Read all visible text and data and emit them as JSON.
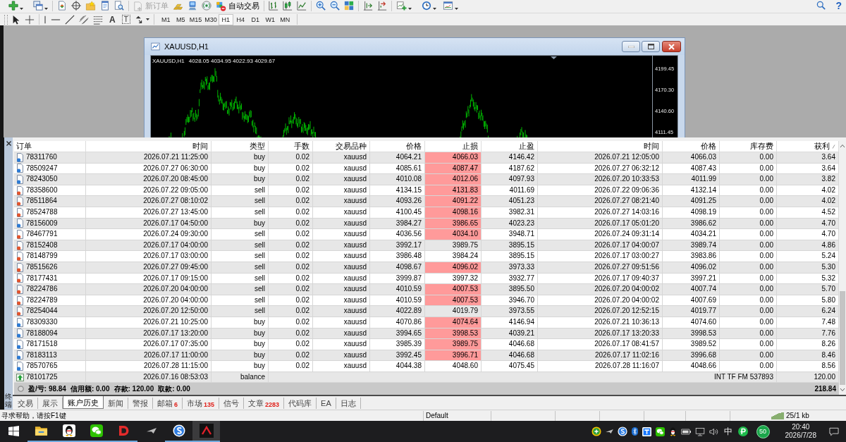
{
  "toolbar": {
    "buttons": [
      {
        "label": "新订单",
        "disabled": true
      },
      {
        "label": "自动交易",
        "disabled": false
      }
    ],
    "help": "?"
  },
  "drawing_toolbar": {
    "text_tool": "A",
    "label_tool": "T"
  },
  "timeframes": [
    {
      "label": "M1",
      "selected": false
    },
    {
      "label": "M5",
      "selected": false
    },
    {
      "label": "M15",
      "selected": false
    },
    {
      "label": "M30",
      "selected": false
    },
    {
      "label": "H1",
      "selected": true
    },
    {
      "label": "H4",
      "selected": false
    },
    {
      "label": "D1",
      "selected": false
    },
    {
      "label": "W1",
      "selected": false
    },
    {
      "label": "MN",
      "selected": false
    }
  ],
  "chart_window": {
    "title": "XAUUSD,H1",
    "symbol": "XAUUSD,H1",
    "ohlc": "4028.05 4034.95 4022.93 4029.67",
    "price_labels": [
      "4199.45",
      "4170.30",
      "4140.60",
      "4111.45"
    ]
  },
  "terminal": {
    "title": "终端",
    "columns": [
      {
        "label": "订单",
        "sorted": false
      },
      {
        "label": "时间",
        "sorted": false
      },
      {
        "label": "类型",
        "sorted": false
      },
      {
        "label": "手数",
        "sorted": false
      },
      {
        "label": "交易品种",
        "sorted": false
      },
      {
        "label": "价格",
        "sorted": false
      },
      {
        "label": "止损",
        "sorted": false
      },
      {
        "label": "止盈",
        "sorted": false
      },
      {
        "label": "时间",
        "sorted": false
      },
      {
        "label": "价格",
        "sorted": false
      },
      {
        "label": "库存费",
        "sorted": false
      },
      {
        "label": "获利",
        "sorted": true
      }
    ],
    "rows": [
      {
        "kind": "buy",
        "order": "78311760",
        "open_time": "2026.07.21 11:25:00",
        "type": "buy",
        "size": "0.02",
        "symbol": "xauusd",
        "price": "4064.21",
        "sl": "4066.03",
        "sl_hit": true,
        "tp": "4146.42",
        "close_time": "2026.07.21 12:05:00",
        "close_price": "4066.03",
        "swap": "0.00",
        "profit": "3.64"
      },
      {
        "kind": "buy",
        "order": "78509247",
        "open_time": "2026.07.27 06:30:00",
        "type": "buy",
        "size": "0.02",
        "symbol": "xauusd",
        "price": "4085.61",
        "sl": "4087.47",
        "sl_hit": true,
        "tp": "4187.62",
        "close_time": "2026.07.27 06:32:12",
        "close_price": "4087.43",
        "swap": "0.00",
        "profit": "3.64"
      },
      {
        "kind": "buy",
        "order": "78243050",
        "open_time": "2026.07.20 08:45:00",
        "type": "buy",
        "size": "0.02",
        "symbol": "xauusd",
        "price": "4010.08",
        "sl": "4012.06",
        "sl_hit": true,
        "tp": "4097.93",
        "close_time": "2026.07.20 10:33:53",
        "close_price": "4011.99",
        "swap": "0.00",
        "profit": "3.82"
      },
      {
        "kind": "sell",
        "order": "78358600",
        "open_time": "2026.07.22 09:05:00",
        "type": "sell",
        "size": "0.02",
        "symbol": "xauusd",
        "price": "4134.15",
        "sl": "4131.83",
        "sl_hit": true,
        "tp": "4011.69",
        "close_time": "2026.07.22 09:06:36",
        "close_price": "4132.14",
        "swap": "0.00",
        "profit": "4.02"
      },
      {
        "kind": "sell",
        "order": "78511864",
        "open_time": "2026.07.27 08:10:02",
        "type": "sell",
        "size": "0.02",
        "symbol": "xauusd",
        "price": "4093.26",
        "sl": "4091.22",
        "sl_hit": true,
        "tp": "4051.23",
        "close_time": "2026.07.27 08:21:40",
        "close_price": "4091.25",
        "swap": "0.00",
        "profit": "4.02"
      },
      {
        "kind": "sell",
        "order": "78524788",
        "open_time": "2026.07.27 13:45:00",
        "type": "sell",
        "size": "0.02",
        "symbol": "xauusd",
        "price": "4100.45",
        "sl": "4098.16",
        "sl_hit": true,
        "tp": "3982.31",
        "close_time": "2026.07.27 14:03:16",
        "close_price": "4098.19",
        "swap": "0.00",
        "profit": "4.52"
      },
      {
        "kind": "buy",
        "order": "78156009",
        "open_time": "2026.07.17 04:50:00",
        "type": "buy",
        "size": "0.02",
        "symbol": "xauusd",
        "price": "3984.27",
        "sl": "3986.65",
        "sl_hit": true,
        "tp": "4023.23",
        "close_time": "2026.07.17 05:01:20",
        "close_price": "3986.62",
        "swap": "0.00",
        "profit": "4.70"
      },
      {
        "kind": "sell",
        "order": "78467791",
        "open_time": "2026.07.24 09:30:00",
        "type": "sell",
        "size": "0.02",
        "symbol": "xauusd",
        "price": "4036.56",
        "sl": "4034.10",
        "sl_hit": true,
        "tp": "3948.71",
        "close_time": "2026.07.24 09:31:14",
        "close_price": "4034.21",
        "swap": "0.00",
        "profit": "4.70"
      },
      {
        "kind": "sell",
        "order": "78152408",
        "open_time": "2026.07.17 04:00:00",
        "type": "sell",
        "size": "0.02",
        "symbol": "xauusd",
        "price": "3992.17",
        "sl": "3989.75",
        "sl_hit": false,
        "tp": "3895.15",
        "close_time": "2026.07.17 04:00:07",
        "close_price": "3989.74",
        "swap": "0.00",
        "profit": "4.86"
      },
      {
        "kind": "sell",
        "order": "78148799",
        "open_time": "2026.07.17 03:00:00",
        "type": "sell",
        "size": "0.02",
        "symbol": "xauusd",
        "price": "3986.48",
        "sl": "3984.24",
        "sl_hit": false,
        "tp": "3895.15",
        "close_time": "2026.07.17 03:00:27",
        "close_price": "3983.86",
        "swap": "0.00",
        "profit": "5.24"
      },
      {
        "kind": "sell",
        "order": "78515626",
        "open_time": "2026.07.27 09:45:00",
        "type": "sell",
        "size": "0.02",
        "symbol": "xauusd",
        "price": "4098.67",
        "sl": "4096.02",
        "sl_hit": true,
        "tp": "3973.33",
        "close_time": "2026.07.27 09:51:56",
        "close_price": "4096.02",
        "swap": "0.00",
        "profit": "5.30"
      },
      {
        "kind": "sell",
        "order": "78177431",
        "open_time": "2026.07.17 09:15:00",
        "type": "sell",
        "size": "0.02",
        "symbol": "xauusd",
        "price": "3999.87",
        "sl": "3997.32",
        "sl_hit": false,
        "tp": "3932.77",
        "close_time": "2026.07.17 09:40:37",
        "close_price": "3997.21",
        "swap": "0.00",
        "profit": "5.32"
      },
      {
        "kind": "sell",
        "order": "78224786",
        "open_time": "2026.07.20 04:00:00",
        "type": "sell",
        "size": "0.02",
        "symbol": "xauusd",
        "price": "4010.59",
        "sl": "4007.53",
        "sl_hit": true,
        "tp": "3895.50",
        "close_time": "2026.07.20 04:00:02",
        "close_price": "4007.74",
        "swap": "0.00",
        "profit": "5.70"
      },
      {
        "kind": "sell",
        "order": "78224789",
        "open_time": "2026.07.20 04:00:00",
        "type": "sell",
        "size": "0.02",
        "symbol": "xauusd",
        "price": "4010.59",
        "sl": "4007.53",
        "sl_hit": true,
        "tp": "3946.70",
        "close_time": "2026.07.20 04:00:02",
        "close_price": "4007.69",
        "swap": "0.00",
        "profit": "5.80"
      },
      {
        "kind": "sell",
        "order": "78254044",
        "open_time": "2026.07.20 12:50:00",
        "type": "sell",
        "size": "0.02",
        "symbol": "xauusd",
        "price": "4022.89",
        "sl": "4019.79",
        "sl_hit": false,
        "tp": "3973.55",
        "close_time": "2026.07.20 12:52:15",
        "close_price": "4019.77",
        "swap": "0.00",
        "profit": "6.24"
      },
      {
        "kind": "buy",
        "order": "78309330",
        "open_time": "2026.07.21 10:25:00",
        "type": "buy",
        "size": "0.02",
        "symbol": "xauusd",
        "price": "4070.86",
        "sl": "4074.64",
        "sl_hit": true,
        "tp": "4146.94",
        "close_time": "2026.07.21 10:36:13",
        "close_price": "4074.60",
        "swap": "0.00",
        "profit": "7.48"
      },
      {
        "kind": "buy",
        "order": "78188094",
        "open_time": "2026.07.17 13:20:00",
        "type": "buy",
        "size": "0.02",
        "symbol": "xauusd",
        "price": "3994.65",
        "sl": "3998.53",
        "sl_hit": true,
        "tp": "4039.21",
        "close_time": "2026.07.17 13:20:33",
        "close_price": "3998.53",
        "swap": "0.00",
        "profit": "7.76"
      },
      {
        "kind": "buy",
        "order": "78171518",
        "open_time": "2026.07.17 07:35:00",
        "type": "buy",
        "size": "0.02",
        "symbol": "xauusd",
        "price": "3985.39",
        "sl": "3989.75",
        "sl_hit": true,
        "tp": "4046.68",
        "close_time": "2026.07.17 08:41:57",
        "close_price": "3989.52",
        "swap": "0.00",
        "profit": "8.26"
      },
      {
        "kind": "buy",
        "order": "78183113",
        "open_time": "2026.07.17 11:00:00",
        "type": "buy",
        "size": "0.02",
        "symbol": "xauusd",
        "price": "3992.45",
        "sl": "3996.71",
        "sl_hit": true,
        "tp": "4046.68",
        "close_time": "2026.07.17 11:02:16",
        "close_price": "3996.68",
        "swap": "0.00",
        "profit": "8.46"
      },
      {
        "kind": "buy",
        "order": "78570765",
        "open_time": "2026.07.28 11:15:00",
        "type": "buy",
        "size": "0.02",
        "symbol": "xauusd",
        "price": "4044.38",
        "sl": "4048.60",
        "sl_hit": false,
        "tp": "4075.45",
        "close_time": "2026.07.28 11:16:07",
        "close_price": "4048.66",
        "swap": "0.00",
        "profit": "8.56"
      },
      {
        "kind": "balance",
        "order": "78101725",
        "open_time": "2026.07.16 08:53:03",
        "type": "balance",
        "comment": "INT TF FM 537893",
        "profit": "120.00"
      }
    ],
    "summary": [
      "盈/亏: 98.84",
      "信用额: 0.00",
      "存款: 120.00",
      "取款: 0.00"
    ],
    "total": "218.84"
  },
  "tabs": [
    {
      "label": "交易",
      "selected": false
    },
    {
      "label": "展示",
      "selected": false
    },
    {
      "label": "账户历史",
      "selected": true
    },
    {
      "label": "新闻",
      "selected": false
    },
    {
      "label": "警报",
      "selected": false
    },
    {
      "label": "邮箱",
      "count": "6",
      "selected": false
    },
    {
      "label": "市场",
      "count": "135",
      "selected": false
    },
    {
      "label": "信号",
      "selected": false
    },
    {
      "label": "文章",
      "count": "2283",
      "selected": false
    },
    {
      "label": "代码库",
      "selected": false
    },
    {
      "label": "EA",
      "selected": false
    },
    {
      "label": "日志",
      "selected": false
    }
  ],
  "status_bar": {
    "help": "寻求帮助，请按F1键",
    "profile": "Default",
    "traffic": "25/1 kb"
  },
  "taskbar": {
    "apps": [
      {
        "kind": "folder",
        "running": true,
        "selected": false
      },
      {
        "kind": "penguin",
        "running": true,
        "selected": false
      },
      {
        "kind": "chat",
        "running": true,
        "selected": false
      },
      {
        "kind": "ring",
        "running": true,
        "selected": false
      },
      {
        "kind": "plane",
        "running": false,
        "selected": false
      },
      {
        "kind": "swirl",
        "running": true,
        "selected": false
      },
      {
        "kind": "caret",
        "running": true,
        "selected": true
      }
    ],
    "ime": "中",
    "counter": "50",
    "time": "20:40",
    "date": "2026/7/28"
  }
}
